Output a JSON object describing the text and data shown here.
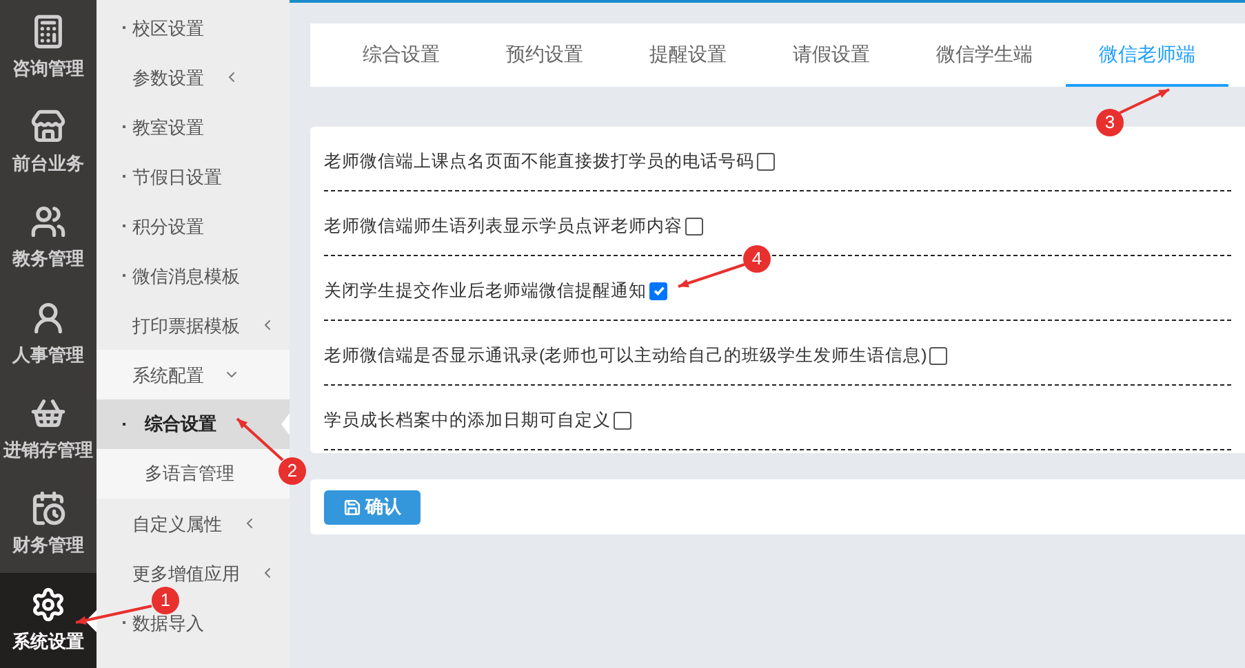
{
  "rail": [
    {
      "label": "咨询管理",
      "selected": false
    },
    {
      "label": "前台业务",
      "selected": false
    },
    {
      "label": "教务管理",
      "selected": false
    },
    {
      "label": "人事管理",
      "selected": false
    },
    {
      "label": "进销存管理",
      "selected": false
    },
    {
      "label": "财务管理",
      "selected": false
    },
    {
      "label": "系统设置",
      "selected": true
    }
  ],
  "submenu": [
    {
      "kind": "link",
      "label": "校区设置"
    },
    {
      "kind": "group",
      "label": "参数设置",
      "expanded": false
    },
    {
      "kind": "link",
      "label": "教室设置"
    },
    {
      "kind": "link",
      "label": "节假日设置"
    },
    {
      "kind": "link",
      "label": "积分设置"
    },
    {
      "kind": "link",
      "label": "微信消息模板"
    },
    {
      "kind": "group",
      "label": "打印票据模板",
      "expanded": false
    },
    {
      "kind": "group",
      "label": "系统配置",
      "expanded": true,
      "children": [
        {
          "label": "综合设置",
          "selected": true
        },
        {
          "label": "多语言管理",
          "selected": false
        }
      ]
    },
    {
      "kind": "group",
      "label": "自定义属性",
      "expanded": false
    },
    {
      "kind": "group",
      "label": "更多增值应用",
      "expanded": false
    },
    {
      "kind": "link",
      "label": "数据导入"
    }
  ],
  "tabs": [
    {
      "label": "综合设置",
      "selected": false
    },
    {
      "label": "预约设置",
      "selected": false
    },
    {
      "label": "提醒设置",
      "selected": false
    },
    {
      "label": "请假设置",
      "selected": false
    },
    {
      "label": "微信学生端",
      "selected": false
    },
    {
      "label": "微信老师端",
      "selected": true
    }
  ],
  "settings": [
    {
      "label": "老师微信端上课点名页面不能直接拨打学员的电话号码",
      "checked": false
    },
    {
      "label": "老师微信端师生语列表显示学员点评老师内容",
      "checked": false
    },
    {
      "label": "关闭学生提交作业后老师端微信提醒通知",
      "checked": true
    },
    {
      "label": "老师微信端是否显示通讯录(老师也可以主动给自己的班级学生发师生语信息)",
      "checked": false
    },
    {
      "label": "学员成长档案中的添加日期可自定义",
      "checked": false
    }
  ],
  "confirm_button": "确认",
  "annotations": [
    {
      "number": "1"
    },
    {
      "number": "2"
    },
    {
      "number": "3"
    },
    {
      "number": "4"
    }
  ]
}
